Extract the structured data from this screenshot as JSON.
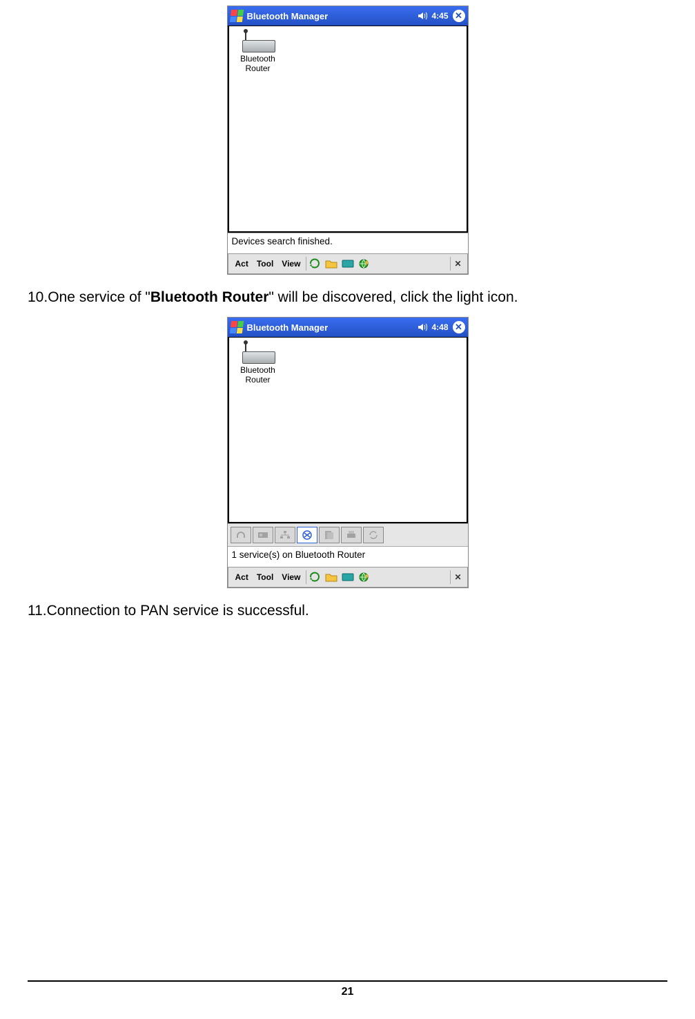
{
  "screens": [
    {
      "title": "Bluetooth Manager",
      "time": "4:45",
      "device_label1": "Bluetooth",
      "device_label2": "Router",
      "status": "Devices search finished.",
      "show_service_bar": false
    },
    {
      "title": "Bluetooth Manager",
      "time": "4:48",
      "device_label1": "Bluetooth",
      "device_label2": "Router",
      "status": "1 service(s) on Bluetooth Router",
      "show_service_bar": true
    }
  ],
  "toolbar": {
    "act": "Act",
    "tool": "Tool",
    "view": "View"
  },
  "step10": {
    "num": "10.",
    "before": "One service of \"",
    "bold": "Bluetooth Router",
    "after": "\" will be discovered, click the light icon."
  },
  "step11": {
    "num": "11.",
    "text": "Connection to PAN service is successful."
  },
  "page_number": "21"
}
